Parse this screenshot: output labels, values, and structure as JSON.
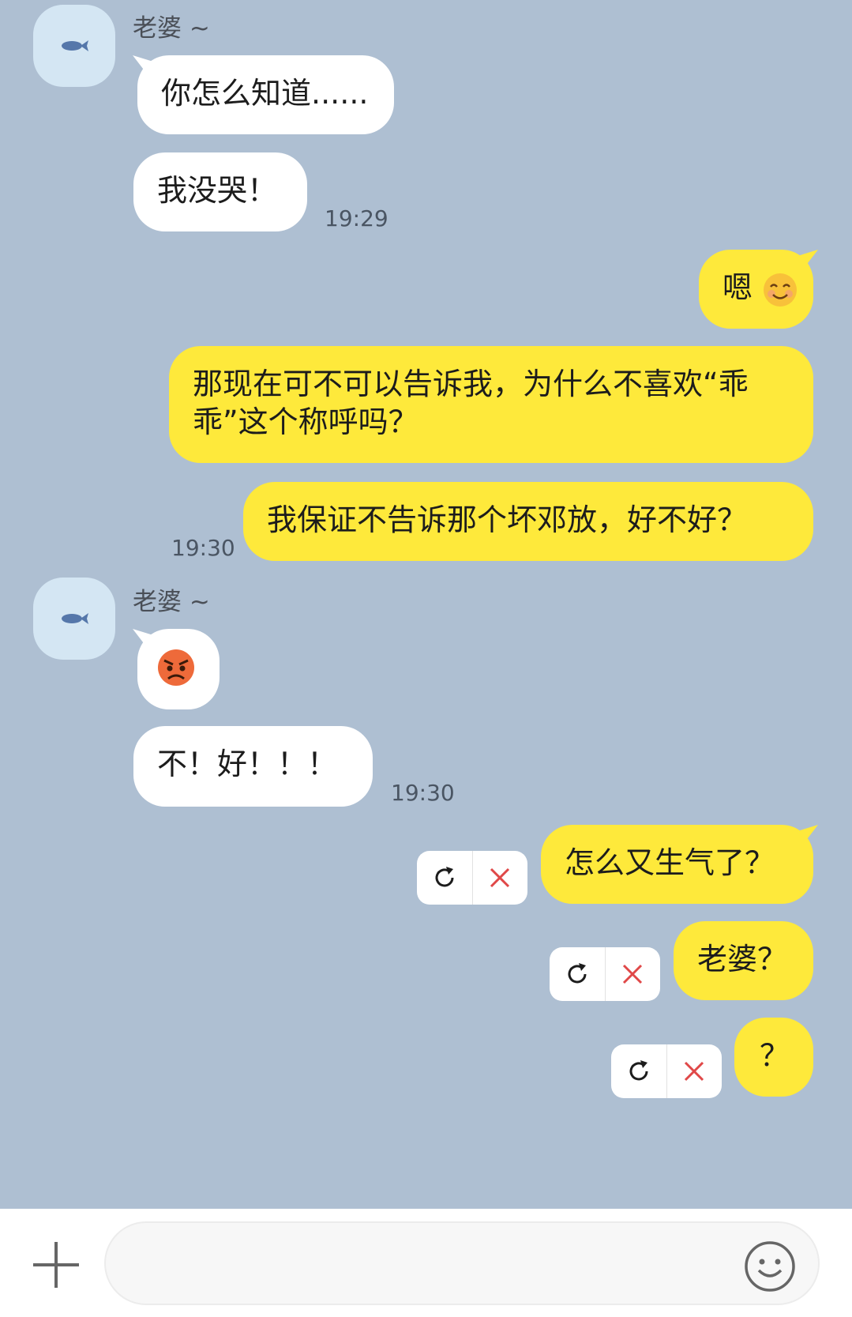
{
  "contact_name": "老婆 ~",
  "colors": {
    "background": "#aebfd2",
    "incoming": "#ffffff",
    "outgoing": "#fee93b",
    "retry_x": "#e04848"
  },
  "messages": {
    "m1": "你怎么知道......",
    "m2": "我没哭！",
    "t1": "19:29",
    "m3": "嗯",
    "m4": "那现在可不可以告诉我，为什么不喜欢“乖乖”这个称呼吗？",
    "m5": "我保证不告诉那个坏邓放，好不好？",
    "t2": "19:30",
    "m7": "不！好！！！",
    "t3": "19:30",
    "m8": "怎么又生气了？",
    "m9": "老婆？",
    "m10": "？"
  },
  "icons": {
    "avatar": "fish-icon",
    "smile": "smiling-face-emoji",
    "angry": "angry-face-emoji",
    "retry": "refresh-icon",
    "delete": "close-icon",
    "add": "plus-icon",
    "emoji_button": "smiley-icon"
  },
  "composer": {
    "placeholder": ""
  }
}
